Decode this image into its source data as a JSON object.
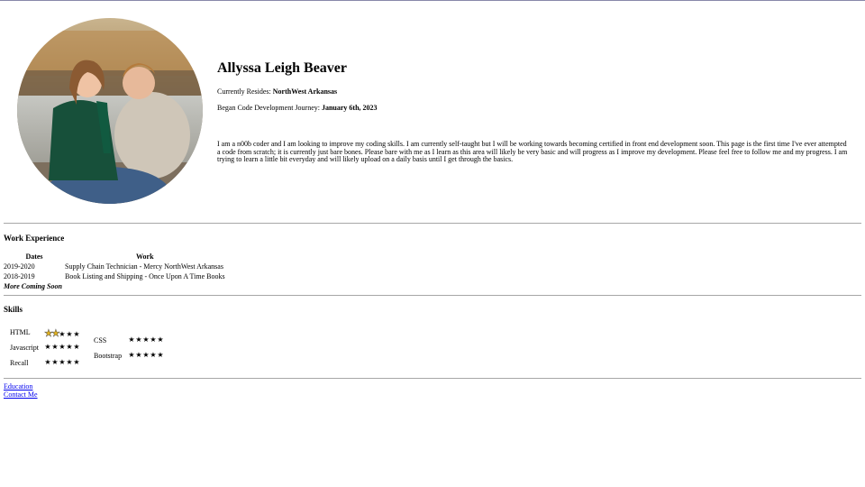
{
  "profile": {
    "name": "Allyssa Leigh Beaver",
    "resides_label": "Currently Resides: ",
    "resides_value": "NorthWest Arkansas",
    "journey_label": "Began Code Development Journey: ",
    "journey_value": "January 6th, 2023",
    "bio": "I am a n00b coder and I am looking to improve my coding skills. I am currently self-taught but I will be working towards becoming certified in front end development soon. This page is the first time I've ever attempted a code from scratch; it is currently just bare bones. Please bare with me as I learn as this area will likely be very basic and will progress as I improve my development. Please feel free to follow me and my progress. I am trying to learn a little bit everyday and will likely upload on a daily basis until I get through the basics."
  },
  "work": {
    "title": "Work Experience",
    "headers": [
      "Dates",
      "Work"
    ],
    "rows": [
      {
        "dates": "2019-2020",
        "work": "Supply Chain Technician - Mercy NorthWest Arkansas"
      },
      {
        "dates": "2018-2019",
        "work": "Book Listing and Shipping - Once Upon A Time Books"
      }
    ],
    "footer": "More Coming Soon"
  },
  "skills": {
    "title": "Skills",
    "items": [
      {
        "label": "HTML",
        "rating": 2,
        "max": 5
      },
      {
        "label": "Javascript",
        "rating": 0,
        "max": 5
      },
      {
        "label": "Recall",
        "rating": 0,
        "max": 5
      },
      {
        "label": "CSS",
        "rating": 0,
        "max": 5
      },
      {
        "label": "Bootstrap",
        "rating": 0,
        "max": 5
      }
    ]
  },
  "links": {
    "education": "Education",
    "contact": "Contact Me"
  },
  "colors": {
    "link": "#0000ee",
    "star_filled": "#e3b21c",
    "rule": "#a7a7a7"
  }
}
